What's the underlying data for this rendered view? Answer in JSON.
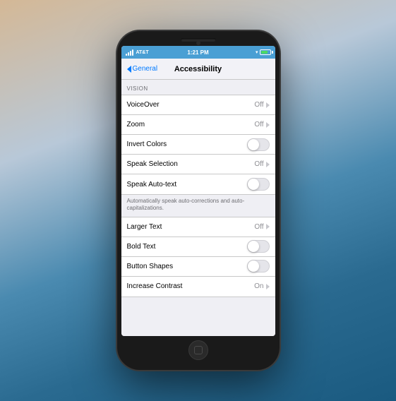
{
  "background": {
    "gradient": "ocean-wave"
  },
  "status_bar": {
    "carrier": "AT&T",
    "signal": "full",
    "time": "1:21 PM",
    "wifi": true,
    "battery_pct": 80
  },
  "nav": {
    "back_label": "General",
    "title": "Accessibility"
  },
  "vision_section": {
    "header": "VISION",
    "items": [
      {
        "id": "voiceover",
        "label": "VoiceOver",
        "type": "value-chevron",
        "value": "Off"
      },
      {
        "id": "zoom",
        "label": "Zoom",
        "type": "value-chevron",
        "value": "Off"
      },
      {
        "id": "invert-colors",
        "label": "Invert Colors",
        "type": "toggle",
        "on": false
      },
      {
        "id": "speak-selection",
        "label": "Speak Selection",
        "type": "value-chevron",
        "value": "Off"
      },
      {
        "id": "speak-auto-text",
        "label": "Speak Auto-text",
        "type": "toggle",
        "on": false
      }
    ],
    "speak_auto_text_description": "Automatically speak auto-corrections and auto-capitalizations."
  },
  "more_section": {
    "items": [
      {
        "id": "larger-text",
        "label": "Larger Text",
        "type": "value-chevron",
        "value": "Off"
      },
      {
        "id": "bold-text",
        "label": "Bold Text",
        "type": "toggle",
        "on": false
      },
      {
        "id": "button-shapes",
        "label": "Button Shapes",
        "type": "toggle",
        "on": false
      },
      {
        "id": "increase-contrast",
        "label": "Increase Contrast",
        "type": "value-chevron",
        "value": "On"
      }
    ]
  }
}
